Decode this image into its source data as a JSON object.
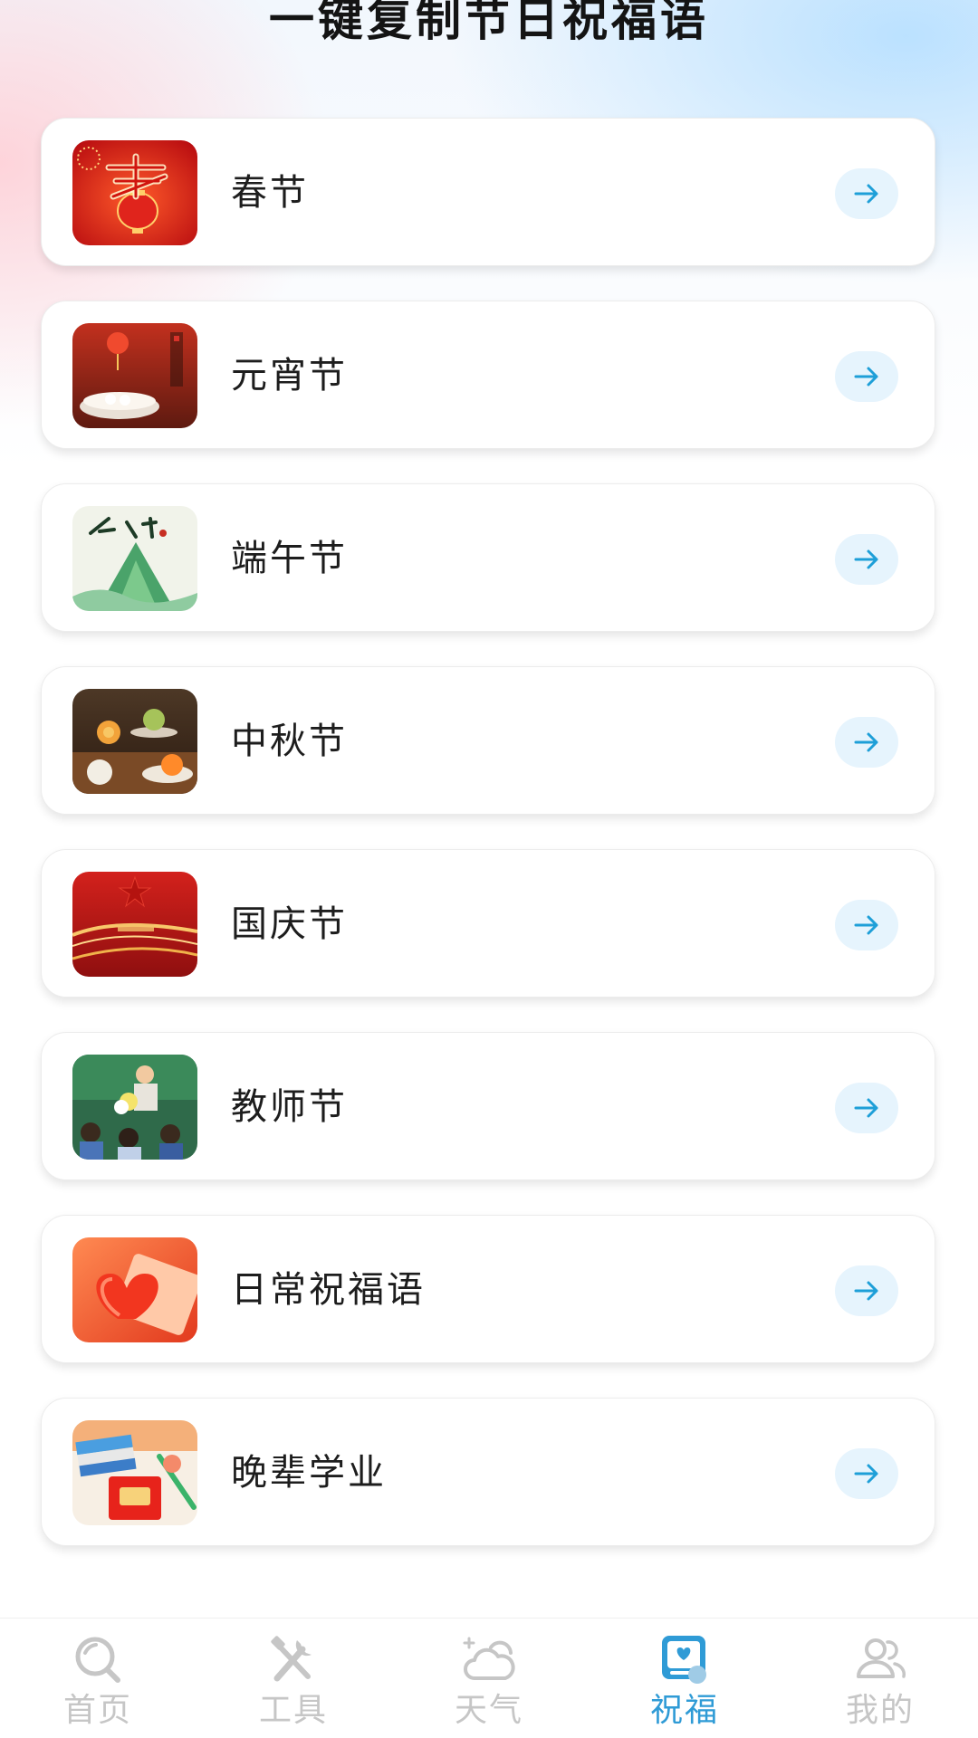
{
  "header": {
    "title": "一键复制节日祝福语"
  },
  "festivals": [
    {
      "label": "春节",
      "thumb_icon": "spring-festival-thumbnail"
    },
    {
      "label": "元宵节",
      "thumb_icon": "lantern-festival-thumbnail"
    },
    {
      "label": "端午节",
      "thumb_icon": "dragon-boat-festival-thumbnail"
    },
    {
      "label": "中秋节",
      "thumb_icon": "mid-autumn-festival-thumbnail"
    },
    {
      "label": "国庆节",
      "thumb_icon": "national-day-thumbnail"
    },
    {
      "label": "教师节",
      "thumb_icon": "teachers-day-thumbnail"
    },
    {
      "label": "日常祝福语",
      "thumb_icon": "daily-blessings-thumbnail"
    },
    {
      "label": "晚辈学业",
      "thumb_icon": "studies-thumbnail"
    }
  ],
  "arrow_icon": "arrow-right-icon",
  "tabbar": {
    "active_index": 3,
    "tabs": [
      {
        "label": "首页",
        "icon": "search-icon"
      },
      {
        "label": "工具",
        "icon": "tools-icon"
      },
      {
        "label": "天气",
        "icon": "weather-icon"
      },
      {
        "label": "祝福",
        "icon": "blessing-icon"
      },
      {
        "label": "我的",
        "icon": "user-icon"
      }
    ]
  },
  "colors": {
    "accent": "#2f9bd6",
    "tab_inactive": "#c6c6c6",
    "arrow_bg": "#e6f4fd",
    "card_bg": "#ffffff"
  }
}
